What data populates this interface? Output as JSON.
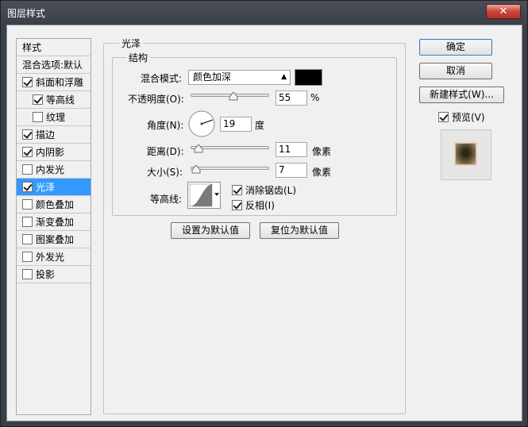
{
  "window": {
    "title": "图层样式",
    "close_label": "✕"
  },
  "sidebar": {
    "header": "样式",
    "blend_options": "混合选项:默认",
    "items": [
      {
        "label": "斜面和浮雕",
        "checked": true
      },
      {
        "label": "等高线",
        "checked": true
      },
      {
        "label": "纹理",
        "checked": false
      },
      {
        "label": "描边",
        "checked": true
      },
      {
        "label": "内阴影",
        "checked": true
      },
      {
        "label": "内发光",
        "checked": false
      },
      {
        "label": "光泽",
        "checked": true,
        "selected": true
      },
      {
        "label": "颜色叠加",
        "checked": false
      },
      {
        "label": "渐变叠加",
        "checked": false
      },
      {
        "label": "图案叠加",
        "checked": false
      },
      {
        "label": "外发光",
        "checked": false
      },
      {
        "label": "投影",
        "checked": false
      }
    ]
  },
  "satin": {
    "group_title": "光泽",
    "structure_title": "结构",
    "blend_mode_label": "混合模式:",
    "blend_mode_value": "颜色加深",
    "blend_color": "#000000",
    "opacity_label": "不透明度(O):",
    "opacity_value": "55",
    "opacity_unit": "%",
    "angle_label": "角度(N):",
    "angle_value": "19",
    "angle_unit": "度",
    "distance_label": "距离(D):",
    "distance_value": "11",
    "distance_unit": "像素",
    "size_label": "大小(S):",
    "size_value": "7",
    "size_unit": "像素",
    "contour_label": "等高线:",
    "antialias_label": "消除锯齿(L)",
    "antialias_checked": true,
    "invert_label": "反相(I)",
    "invert_checked": true,
    "make_default": "设置为默认值",
    "reset_default": "复位为默认值"
  },
  "actions": {
    "ok": "确定",
    "cancel": "取消",
    "new_style": "新建样式(W)...",
    "preview_label": "预览(V)",
    "preview_checked": true
  }
}
